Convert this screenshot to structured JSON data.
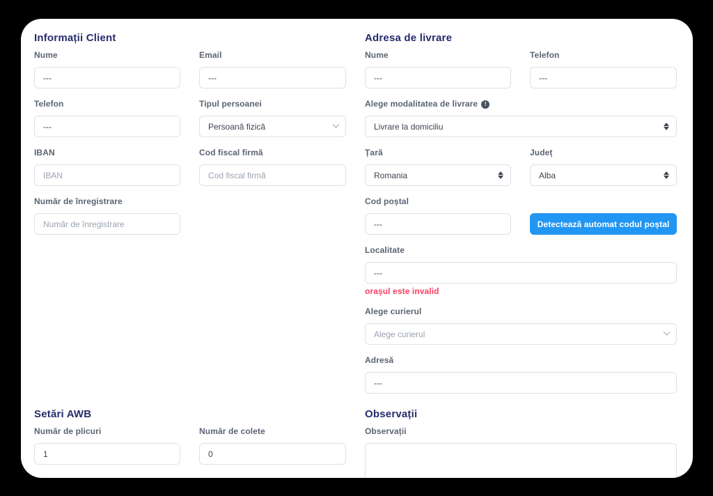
{
  "colors": {
    "accent": "#2196f3",
    "heading": "#252c6b",
    "error": "#fb3e60",
    "background": "#000000"
  },
  "client": {
    "title": "Informații Client",
    "nume_label": "Nume",
    "nume_value": "---",
    "email_label": "Email",
    "email_value": "---",
    "telefon_label": "Telefon",
    "telefon_value": "---",
    "tip_label": "Tipul persoanei",
    "tip_value": "Persoană fizică",
    "iban_label": "IBAN",
    "iban_placeholder": "IBAN",
    "codfiscal_label": "Cod fiscal firmă",
    "codfiscal_placeholder": "Cod fiscal firmă",
    "nrreg_label": "Număr de înregistrare",
    "nrreg_placeholder": "Număr de înregistrare"
  },
  "delivery": {
    "title": "Adresa de livrare",
    "nume_label": "Nume",
    "nume_value": "---",
    "telefon_label": "Telefon",
    "telefon_value": "---",
    "modalitate_label": "Alege modalitatea de livrare",
    "modalitate_info_icon": "exclamation-circle-icon",
    "modalitate_value": "Livrare la domiciliu",
    "tara_label": "Țară",
    "tara_value": "Romania",
    "judet_label": "Județ",
    "judet_value": "Alba",
    "codpostal_label": "Cod poștal",
    "codpostal_value": "---",
    "detect_button_label": "Detectează automat codul poștal",
    "localitate_label": "Localitate",
    "localitate_value": "---",
    "localitate_error": "orașul este invalid",
    "curier_label": "Alege curierul",
    "curier_placeholder": "Alege curierul",
    "adresa_label": "Adresă",
    "adresa_value": "---"
  },
  "awb": {
    "title": "Setări AWB",
    "plicuri_label": "Număr de plicuri",
    "plicuri_value": "1",
    "colete_label": "Număr de colete",
    "colete_value": "0"
  },
  "observatii": {
    "title": "Observații",
    "label": "Observații",
    "value": ""
  }
}
